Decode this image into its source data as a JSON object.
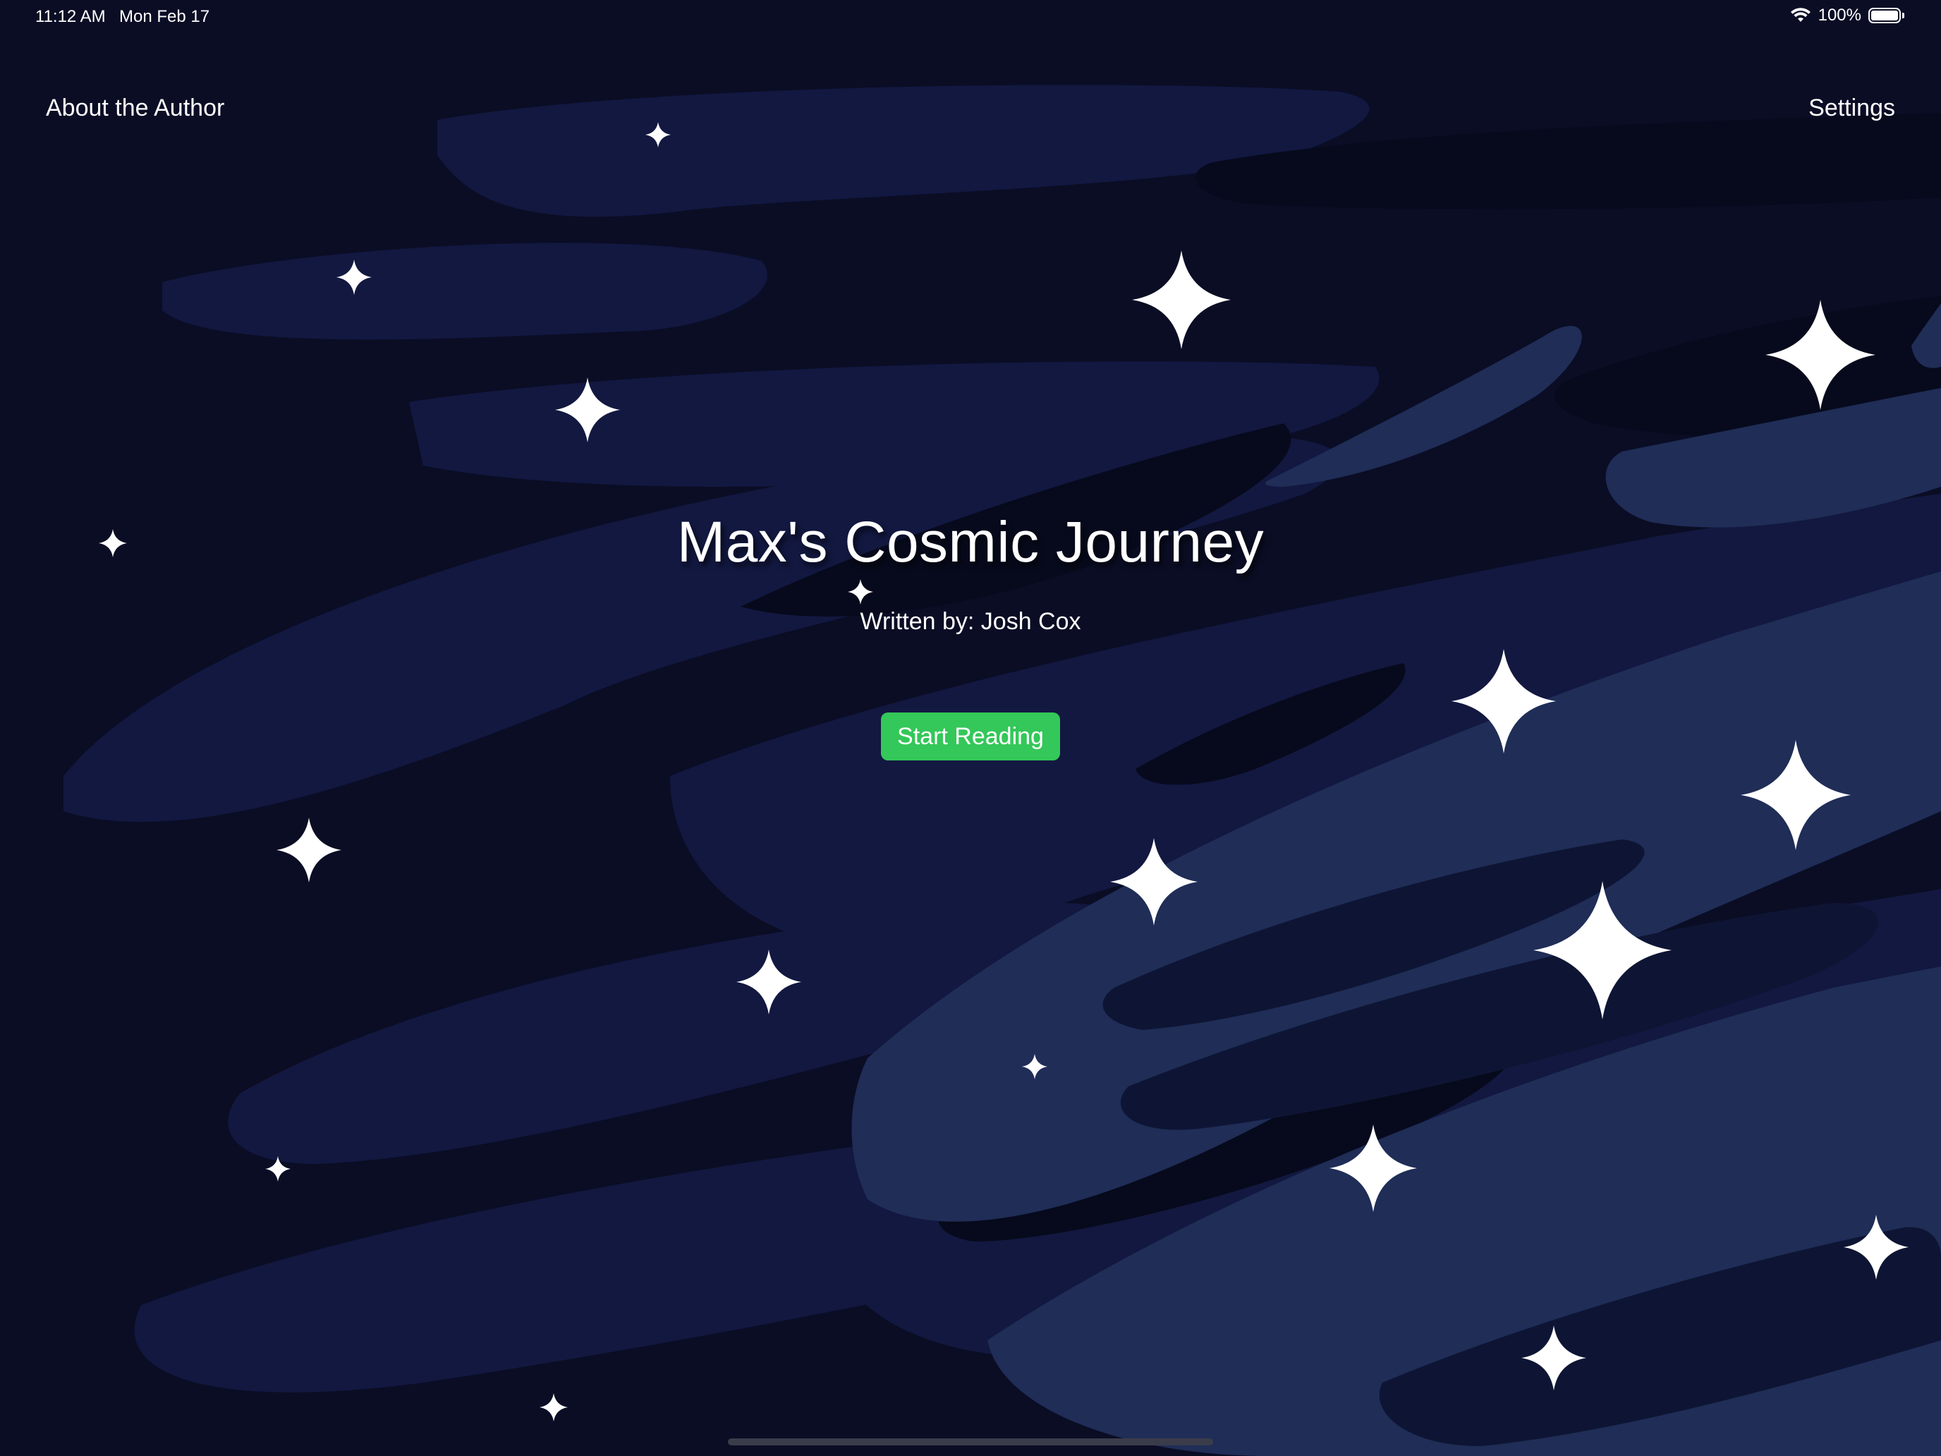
{
  "status_bar": {
    "time": "11:12 AM",
    "date": "Mon Feb 17",
    "battery": "100%",
    "wifi_icon": "wifi-icon",
    "battery_icon": "battery-icon",
    "battery_level": 1.0
  },
  "nav": {
    "left_label": "About the Author",
    "right_label": "Settings"
  },
  "book": {
    "title": "Max's Cosmic Journey",
    "byline": "Written by: Josh Cox"
  },
  "actions": {
    "start_label": "Start Reading"
  },
  "colors": {
    "background": "#0a0d24",
    "band_dark": "#070a1c",
    "band_mid": "#121840",
    "band_light": "#1f2d57",
    "accent_button": "#34c759",
    "text": "#ffffff"
  },
  "decor": {
    "star_icon": "sparkle-star-icon"
  }
}
